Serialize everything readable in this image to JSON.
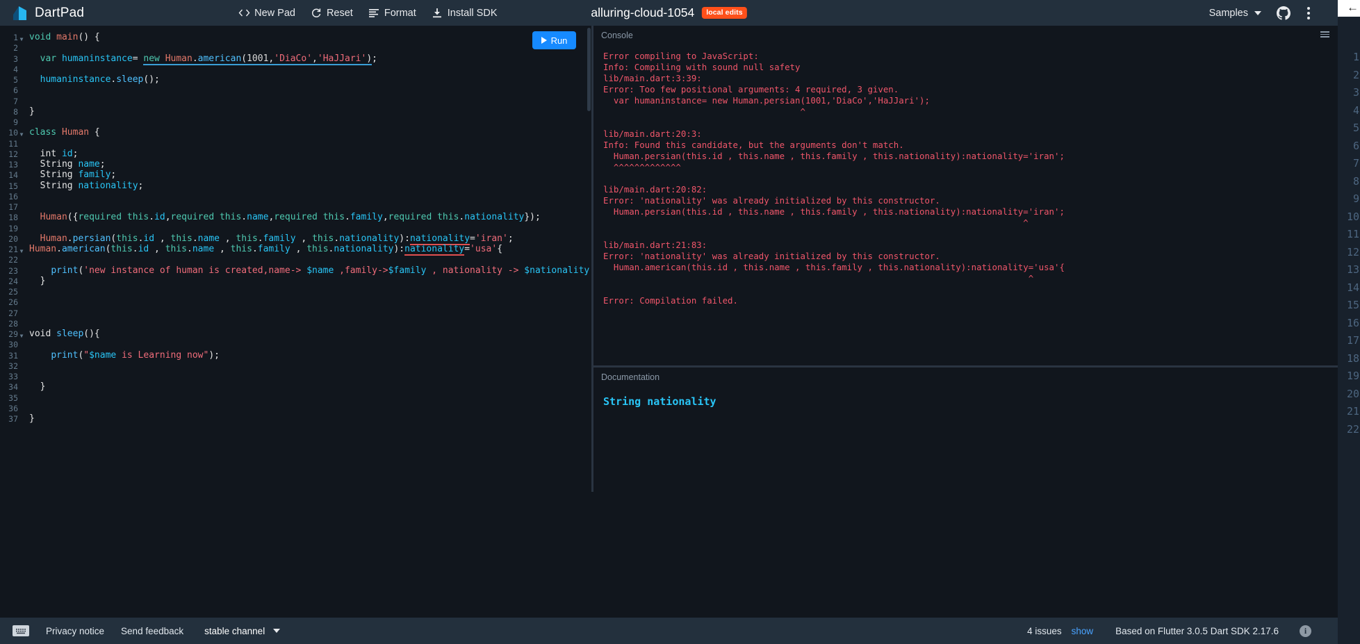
{
  "header": {
    "brand": "DartPad",
    "logo_icon": "dart-logo-icon",
    "actions": [
      {
        "label": "New Pad",
        "icon": "code-brackets-icon"
      },
      {
        "label": "Reset",
        "icon": "refresh-icon"
      },
      {
        "label": "Format",
        "icon": "format-align-icon"
      },
      {
        "label": "Install SDK",
        "icon": "download-icon"
      }
    ],
    "pad_name": "alluring-cloud-1054",
    "badge": "local edits",
    "samples_label": "Samples",
    "github_icon": "github-icon",
    "more_icon": "kebab-menu-icon"
  },
  "run_button": {
    "label": "Run",
    "icon": "play-icon"
  },
  "editor": {
    "lines": [
      {
        "n": 1,
        "fold": true,
        "tokens": [
          {
            "t": "void ",
            "c": "kw"
          },
          {
            "t": "main",
            "c": "typ"
          },
          {
            "t": "() {",
            "c": "pl"
          }
        ]
      },
      {
        "n": 2,
        "fold": false,
        "tokens": []
      },
      {
        "n": 3,
        "fold": false,
        "tokens": [
          {
            "t": "  var ",
            "c": "kw"
          },
          {
            "t": "humaninstance",
            "c": "id"
          },
          {
            "t": "= ",
            "c": "pl"
          },
          {
            "t": "new ",
            "c": "kw",
            "u": "info"
          },
          {
            "t": "Human",
            "c": "typ",
            "u": "info"
          },
          {
            "t": ".",
            "c": "pl",
            "u": "info"
          },
          {
            "t": "american",
            "c": "fn",
            "u": "info"
          },
          {
            "t": "(",
            "c": "pl",
            "u": "info"
          },
          {
            "t": "1001",
            "c": "num",
            "u": "info"
          },
          {
            "t": ",",
            "c": "pl",
            "u": "info"
          },
          {
            "t": "'DiaCo'",
            "c": "str",
            "u": "info"
          },
          {
            "t": ",",
            "c": "pl",
            "u": "info"
          },
          {
            "t": "'HaJJari'",
            "c": "str",
            "u": "info"
          },
          {
            "t": ")",
            "c": "pl",
            "u": "info"
          },
          {
            "t": ";",
            "c": "pl"
          }
        ]
      },
      {
        "n": 4,
        "fold": false,
        "tokens": []
      },
      {
        "n": 5,
        "fold": false,
        "tokens": [
          {
            "t": "  ",
            "c": "pl"
          },
          {
            "t": "humaninstance",
            "c": "id"
          },
          {
            "t": ".",
            "c": "pl"
          },
          {
            "t": "sleep",
            "c": "fn"
          },
          {
            "t": "();",
            "c": "pl"
          }
        ]
      },
      {
        "n": 6,
        "fold": false,
        "tokens": []
      },
      {
        "n": 7,
        "fold": false,
        "tokens": []
      },
      {
        "n": 8,
        "fold": false,
        "tokens": [
          {
            "t": "}",
            "c": "pl"
          }
        ]
      },
      {
        "n": 9,
        "fold": false,
        "tokens": []
      },
      {
        "n": 10,
        "fold": true,
        "tokens": [
          {
            "t": "class ",
            "c": "kw"
          },
          {
            "t": "Human",
            "c": "typ"
          },
          {
            "t": " {",
            "c": "pl"
          }
        ]
      },
      {
        "n": 11,
        "fold": false,
        "tokens": []
      },
      {
        "n": 12,
        "fold": false,
        "tokens": [
          {
            "t": "  int ",
            "c": "pl"
          },
          {
            "t": "id",
            "c": "id"
          },
          {
            "t": ";",
            "c": "pl"
          }
        ]
      },
      {
        "n": 13,
        "fold": false,
        "tokens": [
          {
            "t": "  String ",
            "c": "pl"
          },
          {
            "t": "name",
            "c": "id"
          },
          {
            "t": ";",
            "c": "pl"
          }
        ]
      },
      {
        "n": 14,
        "fold": false,
        "tokens": [
          {
            "t": "  String ",
            "c": "pl"
          },
          {
            "t": "family",
            "c": "id"
          },
          {
            "t": ";",
            "c": "pl"
          }
        ]
      },
      {
        "n": 15,
        "fold": false,
        "tokens": [
          {
            "t": "  String ",
            "c": "pl"
          },
          {
            "t": "nationality",
            "c": "id"
          },
          {
            "t": ";",
            "c": "pl"
          }
        ]
      },
      {
        "n": 16,
        "fold": false,
        "tokens": []
      },
      {
        "n": 17,
        "fold": false,
        "tokens": []
      },
      {
        "n": 18,
        "fold": false,
        "tokens": [
          {
            "t": "  ",
            "c": "pl"
          },
          {
            "t": "Human",
            "c": "typ"
          },
          {
            "t": "({",
            "c": "pl"
          },
          {
            "t": "required ",
            "c": "kw"
          },
          {
            "t": "this",
            "c": "kw"
          },
          {
            "t": ".",
            "c": "pl"
          },
          {
            "t": "id",
            "c": "id"
          },
          {
            "t": ",",
            "c": "pl"
          },
          {
            "t": "required ",
            "c": "kw"
          },
          {
            "t": "this",
            "c": "kw"
          },
          {
            "t": ".",
            "c": "pl"
          },
          {
            "t": "name",
            "c": "id"
          },
          {
            "t": ",",
            "c": "pl"
          },
          {
            "t": "required ",
            "c": "kw"
          },
          {
            "t": "this",
            "c": "kw"
          },
          {
            "t": ".",
            "c": "pl"
          },
          {
            "t": "family",
            "c": "id"
          },
          {
            "t": ",",
            "c": "pl"
          },
          {
            "t": "required ",
            "c": "kw"
          },
          {
            "t": "this",
            "c": "kw"
          },
          {
            "t": ".",
            "c": "pl"
          },
          {
            "t": "nationality",
            "c": "id"
          },
          {
            "t": "});",
            "c": "pl"
          }
        ]
      },
      {
        "n": 19,
        "fold": false,
        "tokens": []
      },
      {
        "n": 20,
        "fold": false,
        "tokens": [
          {
            "t": "  ",
            "c": "pl"
          },
          {
            "t": "Human",
            "c": "typ"
          },
          {
            "t": ".",
            "c": "pl"
          },
          {
            "t": "persian",
            "c": "fn"
          },
          {
            "t": "(",
            "c": "pl"
          },
          {
            "t": "this",
            "c": "kw"
          },
          {
            "t": ".",
            "c": "pl"
          },
          {
            "t": "id",
            "c": "id"
          },
          {
            "t": " , ",
            "c": "pl"
          },
          {
            "t": "this",
            "c": "kw"
          },
          {
            "t": ".",
            "c": "pl"
          },
          {
            "t": "name",
            "c": "id"
          },
          {
            "t": " , ",
            "c": "pl"
          },
          {
            "t": "this",
            "c": "kw"
          },
          {
            "t": ".",
            "c": "pl"
          },
          {
            "t": "family",
            "c": "id"
          },
          {
            "t": " , ",
            "c": "pl"
          },
          {
            "t": "this",
            "c": "kw"
          },
          {
            "t": ".",
            "c": "pl"
          },
          {
            "t": "nationality",
            "c": "id"
          },
          {
            "t": "):",
            "c": "pl"
          },
          {
            "t": "nationality",
            "c": "id",
            "u": "err"
          },
          {
            "t": "=",
            "c": "pl"
          },
          {
            "t": "'iran'",
            "c": "str"
          },
          {
            "t": ";",
            "c": "pl"
          }
        ]
      },
      {
        "n": 21,
        "fold": true,
        "tokens": [
          {
            "t": "Human",
            "c": "typ"
          },
          {
            "t": ".",
            "c": "pl"
          },
          {
            "t": "american",
            "c": "fn"
          },
          {
            "t": "(",
            "c": "pl"
          },
          {
            "t": "this",
            "c": "kw"
          },
          {
            "t": ".",
            "c": "pl"
          },
          {
            "t": "id",
            "c": "id"
          },
          {
            "t": " , ",
            "c": "pl"
          },
          {
            "t": "this",
            "c": "kw"
          },
          {
            "t": ".",
            "c": "pl"
          },
          {
            "t": "name",
            "c": "id"
          },
          {
            "t": " , ",
            "c": "pl"
          },
          {
            "t": "this",
            "c": "kw"
          },
          {
            "t": ".",
            "c": "pl"
          },
          {
            "t": "family",
            "c": "id"
          },
          {
            "t": " , ",
            "c": "pl"
          },
          {
            "t": "this",
            "c": "kw"
          },
          {
            "t": ".",
            "c": "pl"
          },
          {
            "t": "nationality",
            "c": "id"
          },
          {
            "t": "):",
            "c": "pl"
          },
          {
            "t": "nationality",
            "c": "id",
            "u": "err"
          },
          {
            "t": "=",
            "c": "pl"
          },
          {
            "t": "'usa'",
            "c": "str"
          },
          {
            "t": "{",
            "c": "pl"
          }
        ]
      },
      {
        "n": 22,
        "fold": false,
        "tokens": []
      },
      {
        "n": 23,
        "fold": false,
        "tokens": [
          {
            "t": "    ",
            "c": "pl"
          },
          {
            "t": "print",
            "c": "fn"
          },
          {
            "t": "(",
            "c": "pl"
          },
          {
            "t": "'new instance of human is created,name-> ",
            "c": "str"
          },
          {
            "t": "$name",
            "c": "id"
          },
          {
            "t": " ,family->",
            "c": "str"
          },
          {
            "t": "$family",
            "c": "id"
          },
          {
            "t": " , nationality -> ",
            "c": "str"
          },
          {
            "t": "$nationality",
            "c": "id"
          },
          {
            "t": "'",
            "c": "str"
          },
          {
            "t": ");",
            "c": "pl"
          }
        ]
      },
      {
        "n": 24,
        "fold": false,
        "tokens": [
          {
            "t": "  }",
            "c": "pl"
          }
        ]
      },
      {
        "n": 25,
        "fold": false,
        "tokens": []
      },
      {
        "n": 26,
        "fold": false,
        "tokens": []
      },
      {
        "n": 27,
        "fold": false,
        "tokens": []
      },
      {
        "n": 28,
        "fold": false,
        "tokens": []
      },
      {
        "n": 29,
        "fold": true,
        "tokens": [
          {
            "t": "void ",
            "c": "pl"
          },
          {
            "t": "sleep",
            "c": "fn"
          },
          {
            "t": "(){",
            "c": "pl"
          }
        ]
      },
      {
        "n": 30,
        "fold": false,
        "tokens": []
      },
      {
        "n": 31,
        "fold": false,
        "tokens": [
          {
            "t": "    ",
            "c": "pl"
          },
          {
            "t": "print",
            "c": "fn"
          },
          {
            "t": "(",
            "c": "pl"
          },
          {
            "t": "\"",
            "c": "str"
          },
          {
            "t": "$name",
            "c": "id"
          },
          {
            "t": " is Learning now\"",
            "c": "str"
          },
          {
            "t": ");",
            "c": "pl"
          }
        ]
      },
      {
        "n": 32,
        "fold": false,
        "tokens": []
      },
      {
        "n": 33,
        "fold": false,
        "tokens": []
      },
      {
        "n": 34,
        "fold": false,
        "tokens": [
          {
            "t": "  }",
            "c": "pl"
          }
        ]
      },
      {
        "n": 35,
        "fold": false,
        "tokens": []
      },
      {
        "n": 36,
        "fold": false,
        "tokens": []
      },
      {
        "n": 37,
        "fold": false,
        "tokens": [
          {
            "t": "}",
            "c": "pl"
          }
        ]
      }
    ]
  },
  "console": {
    "title": "Console",
    "menu_icon": "console-menu-icon",
    "output": "Error compiling to JavaScript:\nInfo: Compiling with sound null safety\nlib/main.dart:3:39:\nError: Too few positional arguments: 4 required, 3 given.\n  var humaninstance= new Human.persian(1001,'DiaCo','HaJJari');\n                                      ^\n\nlib/main.dart:20:3:\nInfo: Found this candidate, but the arguments don't match.\n  Human.persian(this.id , this.name , this.family , this.nationality):nationality='iran';\n  ^^^^^^^^^^^^^\n\nlib/main.dart:20:82:\nError: 'nationality' was already initialized by this constructor.\n  Human.persian(this.id , this.name , this.family , this.nationality):nationality='iran';\n                                                                                 ^\n\nlib/main.dart:21:83:\nError: 'nationality' was already initialized by this constructor.\n  Human.american(this.id , this.name , this.family , this.nationality):nationality='usa'{\n                                                                                  ^\n\nError: Compilation failed."
  },
  "documentation": {
    "title": "Documentation",
    "content": "String nationality"
  },
  "footer": {
    "keyboard_icon": "keyboard-icon",
    "privacy": "Privacy notice",
    "feedback": "Send feedback",
    "channel": "stable channel",
    "issues": "4 issues",
    "show": "show",
    "sdk": "Based on Flutter 3.0.5 Dart SDK 2.17.6",
    "info_icon": "info-icon"
  },
  "right_overlay": {
    "arrow_icon": "back-arrow-icon",
    "gutter_numbers": [
      "1",
      "2",
      "3",
      "4",
      "5",
      "6",
      "7",
      "8",
      "9",
      "10",
      "11",
      "12",
      "13",
      "14",
      "15",
      "16",
      "17",
      "18",
      "19",
      "20",
      "21",
      "22"
    ]
  },
  "colors": {
    "accent": "#168aff",
    "badge": "#ff501a",
    "error": "#f0566a",
    "chrome": "#23303d",
    "editor_bg": "#11161d"
  }
}
